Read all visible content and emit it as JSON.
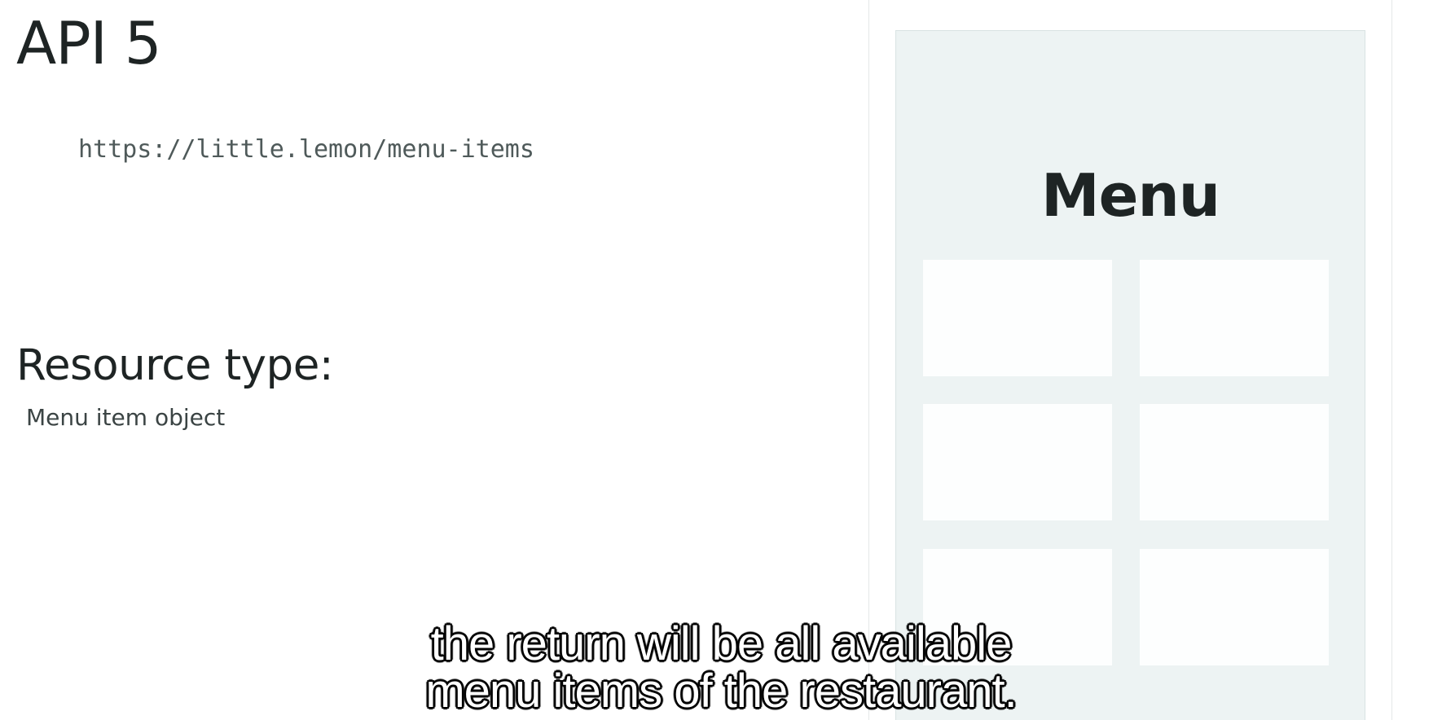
{
  "slide": {
    "title": "API 5",
    "endpoint_url": "https://little.lemon/menu-items",
    "resource_heading": "Resource type:",
    "resource_value": "Menu item object"
  },
  "phone": {
    "title": "Menu",
    "card_count": 6
  },
  "caption": {
    "line1": "the return will be all available",
    "line2": "menu items of the restaurant."
  },
  "colors": {
    "background": "#ffffff",
    "phone_background": "#edf3f3",
    "card_background": "#fdfefe",
    "text_dark": "#1e2424",
    "caption_fill": "#ffffff",
    "caption_outline": "#000000"
  }
}
